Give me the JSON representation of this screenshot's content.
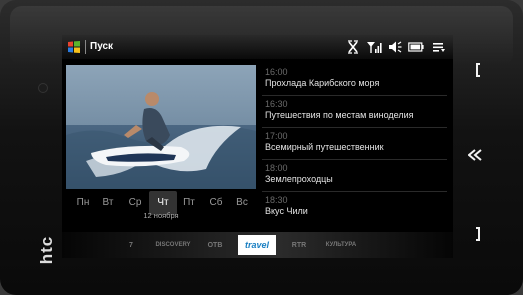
{
  "device": {
    "brand": "htc"
  },
  "statusbar": {
    "start_label": "Пуск",
    "icons": [
      "close-connection-icon",
      "signal-icon",
      "volume-icon",
      "battery-icon",
      "menu-icon"
    ]
  },
  "video": {
    "icon": "jet-ski-image"
  },
  "days": {
    "items": [
      "Пн",
      "Вт",
      "Ср",
      "Чт",
      "Пт",
      "Сб",
      "Вс"
    ],
    "selected": "Чт",
    "date_label": "12 ноября"
  },
  "programs": [
    {
      "time": "16:00",
      "title": "Прохлада Карибского моря"
    },
    {
      "time": "16:30",
      "title": "Путешествия по местам виноделия"
    },
    {
      "time": "17:00",
      "title": "Всемирный путешественник"
    },
    {
      "time": "18:00",
      "title": "Землепроходцы"
    },
    {
      "time": "18:30",
      "title": "Вкус Чили"
    }
  ],
  "channels": {
    "items": [
      "7",
      "DISCOVERY",
      "ОТВ",
      "travel",
      "RTR",
      "КУЛЬТУРА"
    ],
    "selected": "travel",
    "selected_sub": "channel"
  },
  "colors": {
    "accent": "#1a7fc2",
    "screen_bg": "#000000"
  }
}
